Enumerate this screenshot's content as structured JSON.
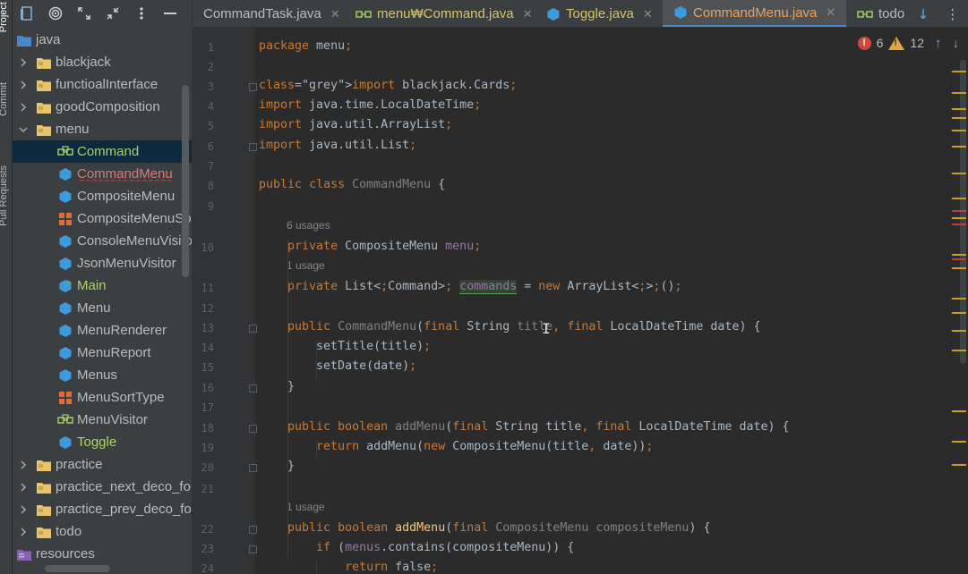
{
  "tool_window_tabs": [
    {
      "label": "Project"
    },
    {
      "label": "Commit"
    },
    {
      "label": "Pull Requests"
    }
  ],
  "project_tree": [
    {
      "label": "java",
      "depth": 0,
      "icon": "java-source-folder-icon",
      "expanded": true
    },
    {
      "label": "blackjack",
      "depth": 1,
      "icon": "package-folder-icon",
      "expanded": false
    },
    {
      "label": "functioalInterface",
      "depth": 1,
      "icon": "package-folder-icon",
      "expanded": false
    },
    {
      "label": "goodComposition",
      "depth": 1,
      "icon": "package-folder-icon",
      "expanded": false
    },
    {
      "label": "menu",
      "depth": 1,
      "icon": "package-folder-icon",
      "expanded": true
    },
    {
      "label": "Command",
      "depth": 2,
      "icon": "interface-icon",
      "style": "green",
      "selected": true
    },
    {
      "label": "CommandMenu",
      "depth": 2,
      "icon": "class-icon",
      "style": "red"
    },
    {
      "label": "CompositeMenu",
      "depth": 2,
      "icon": "class-icon"
    },
    {
      "label": "CompositeMenuSo",
      "depth": 2,
      "icon": "enum-icon"
    },
    {
      "label": "ConsoleMenuVisito",
      "depth": 2,
      "icon": "class-icon"
    },
    {
      "label": "JsonMenuVisitor",
      "depth": 2,
      "icon": "class-icon"
    },
    {
      "label": "Main",
      "depth": 2,
      "icon": "main-class-icon",
      "style": "green"
    },
    {
      "label": "Menu",
      "depth": 2,
      "icon": "class-icon"
    },
    {
      "label": "MenuRenderer",
      "depth": 2,
      "icon": "class-icon"
    },
    {
      "label": "MenuReport",
      "depth": 2,
      "icon": "class-icon"
    },
    {
      "label": "Menus",
      "depth": 2,
      "icon": "class-icon"
    },
    {
      "label": "MenuSortType",
      "depth": 2,
      "icon": "enum-icon"
    },
    {
      "label": "MenuVisitor",
      "depth": 2,
      "icon": "interface-icon"
    },
    {
      "label": "Toggle",
      "depth": 2,
      "icon": "class-icon",
      "style": "green"
    },
    {
      "label": "practice",
      "depth": 1,
      "icon": "package-folder-icon",
      "expanded": false
    },
    {
      "label": "practice_next_deco_fo",
      "depth": 1,
      "icon": "package-folder-icon",
      "expanded": false
    },
    {
      "label": "practice_prev_deco_fo",
      "depth": 1,
      "icon": "package-folder-icon",
      "expanded": false
    },
    {
      "label": "todo",
      "depth": 1,
      "icon": "package-folder-icon",
      "expanded": false
    },
    {
      "label": "resources",
      "depth": 0,
      "icon": "resources-folder-icon"
    }
  ],
  "tabs": [
    {
      "label": "CommandTask.java",
      "style": "plain",
      "icon": "none"
    },
    {
      "label": "menu₩Command.java",
      "style": "yellow",
      "icon": "interface-icon"
    },
    {
      "label": "Toggle.java",
      "style": "yellow",
      "icon": "class-icon"
    },
    {
      "label": "CommandMenu.java",
      "style": "active",
      "icon": "class-icon"
    },
    {
      "label": "todo",
      "style": "plain",
      "icon": "interface-icon"
    }
  ],
  "inspections": {
    "errors": "6",
    "warnings": "12"
  },
  "code_lines": [
    {
      "n": "1",
      "text": "package menu;"
    },
    {
      "n": "2",
      "text": ""
    },
    {
      "n": "3",
      "text": "import blackjack.Cards;"
    },
    {
      "n": "4",
      "text": "import java.time.LocalDateTime;"
    },
    {
      "n": "5",
      "text": "import java.util.ArrayList;"
    },
    {
      "n": "6",
      "text": "import java.util.List;"
    },
    {
      "n": "7",
      "text": ""
    },
    {
      "n": "8",
      "text": "public class CommandMenu {"
    },
    {
      "n": "9",
      "text": ""
    },
    {
      "n": "10",
      "text": "    private CompositeMenu menu;",
      "hint": "6 usages"
    },
    {
      "n": "11",
      "text": "    private List<Command> commands = new ArrayList<>();",
      "hint": "1 usage"
    },
    {
      "n": "12",
      "text": ""
    },
    {
      "n": "13",
      "text": "    public CommandMenu(final String title, final LocalDateTime date) {"
    },
    {
      "n": "14",
      "text": "        setTitle(title);"
    },
    {
      "n": "15",
      "text": "        setDate(date);"
    },
    {
      "n": "16",
      "text": "    }"
    },
    {
      "n": "17",
      "text": ""
    },
    {
      "n": "18",
      "text": "    public boolean addMenu(final String title, final LocalDateTime date) {"
    },
    {
      "n": "19",
      "text": "        return addMenu(new CompositeMenu(title, date));"
    },
    {
      "n": "20",
      "text": "    }"
    },
    {
      "n": "21",
      "text": ""
    },
    {
      "n": "22",
      "text": "    public boolean addMenu(final CompositeMenu compositeMenu) {",
      "hint": "1 usage"
    },
    {
      "n": "23",
      "text": "        if (menus.contains(compositeMenu)) {"
    },
    {
      "n": "24",
      "text": "            return false;"
    }
  ],
  "colors": {
    "keyword": "#cc7832",
    "field": "#9876aa",
    "method": "#ffc66d",
    "selection": "#0d293e",
    "active_tab_text": "#e8a35f",
    "error": "#d3473f",
    "warning": "#e4a53a"
  }
}
